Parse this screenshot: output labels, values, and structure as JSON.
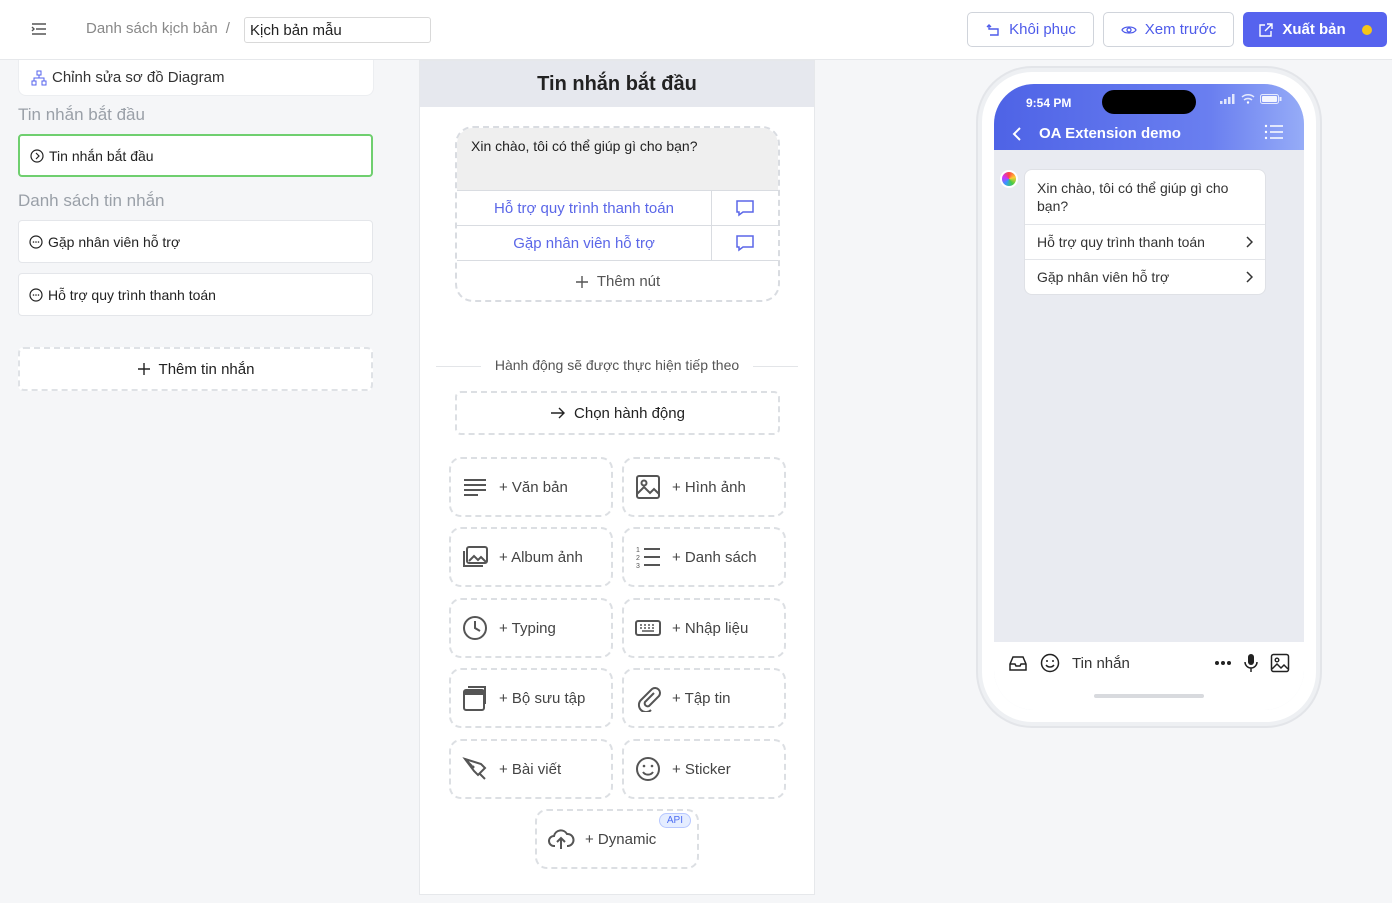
{
  "header": {
    "breadcrumb_root": "Danh sách kịch bản",
    "breadcrumb_sep": "/",
    "title_value": "Kịch bản mẫu",
    "restore_label": "Khôi phục",
    "preview_label": "Xem trước",
    "publish_label": "Xuất bản",
    "accent_color": "#5663ee",
    "status_dot_color": "#f5c518"
  },
  "left": {
    "diagram_label": "Chỉnh sửa sơ đồ Diagram",
    "start_section": "Tin nhắn bắt đầu",
    "start_item": "Tin nhắn bắt đầu",
    "list_section": "Danh sách tin nhắn",
    "items": [
      "Gặp nhân viên hỗ trợ",
      "Hỗ trợ quy trình thanh toán"
    ],
    "add_label": "Thêm tin nhắn"
  },
  "center": {
    "title": "Tin nhắn bắt đầu",
    "message_text": "Xin chào, tôi có thể giúp gì cho bạn?",
    "buttons": [
      "Hỗ trợ quy trình thanh toán",
      "Gặp nhân viên hỗ trợ"
    ],
    "add_button": "Thêm nút",
    "next_action_label": "Hành động sẽ được thực hiện tiếp theo",
    "choose_action": "Chọn hành động",
    "tools": [
      {
        "label": "+ Văn bản",
        "icon": "text-icon"
      },
      {
        "label": "+ Hình ảnh",
        "icon": "image-icon"
      },
      {
        "label": "+ Album ảnh",
        "icon": "album-icon"
      },
      {
        "label": "+ Danh sách",
        "icon": "list-icon"
      },
      {
        "label": "+ Typing",
        "icon": "clock-icon"
      },
      {
        "label": "+ Nhập liệu",
        "icon": "keyboard-icon"
      },
      {
        "label": "+ Bộ sưu tập",
        "icon": "collection-icon"
      },
      {
        "label": "+ Tập tin",
        "icon": "paperclip-icon"
      },
      {
        "label": "+ Bài viết",
        "icon": "pen-icon"
      },
      {
        "label": "+ Sticker",
        "icon": "smile-icon"
      }
    ],
    "dynamic_label": "+ Dynamic",
    "api_badge": "API"
  },
  "phone": {
    "time": "9:54 PM",
    "chat_title": "OA Extension demo",
    "message": "Xin chào, tôi có thể giúp gì cho bạn?",
    "options": [
      "Hỗ trợ quy trình thanh toán",
      "Gặp nhân viên hỗ trợ"
    ],
    "input_placeholder": "Tin nhắn"
  }
}
